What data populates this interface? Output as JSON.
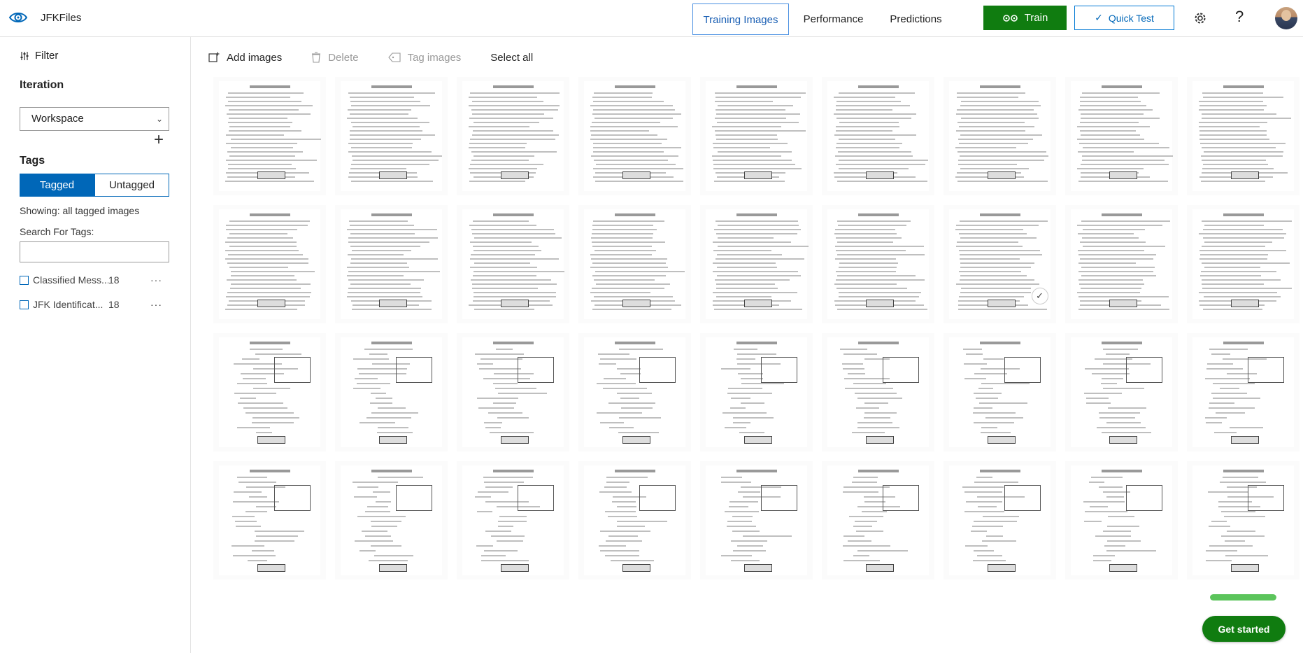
{
  "header": {
    "project_name": "JFKFiles",
    "tabs": [
      {
        "label": "Training Images",
        "active": true
      },
      {
        "label": "Performance",
        "active": false
      },
      {
        "label": "Predictions",
        "active": false
      }
    ],
    "train_label": "Train",
    "quick_test_label": "Quick Test",
    "help_label": "?"
  },
  "sidebar": {
    "filter_label": "Filter",
    "iteration_label": "Iteration",
    "iteration_value": "Workspace",
    "tags_label": "Tags",
    "tagged_label": "Tagged",
    "untagged_label": "Untagged",
    "showing_text": "Showing: all tagged images",
    "search_label": "Search For Tags:",
    "search_value": "",
    "tags": [
      {
        "name": "Classified Mess...",
        "count": "18"
      },
      {
        "name": "JFK Identificat...",
        "count": "18"
      }
    ]
  },
  "toolbar": {
    "add_images": "Add images",
    "delete": "Delete",
    "tag_images": "Tag images",
    "select_all": "Select all"
  },
  "grid": {
    "rows": 4,
    "columns": 9,
    "selected_thumb": "row1-col6"
  },
  "onboarding": {
    "progress": 1.0,
    "get_started_label": "Get started"
  },
  "colors": {
    "accent": "#0067b8",
    "train_green": "#107c10",
    "progress_green": "#5bc45b"
  }
}
